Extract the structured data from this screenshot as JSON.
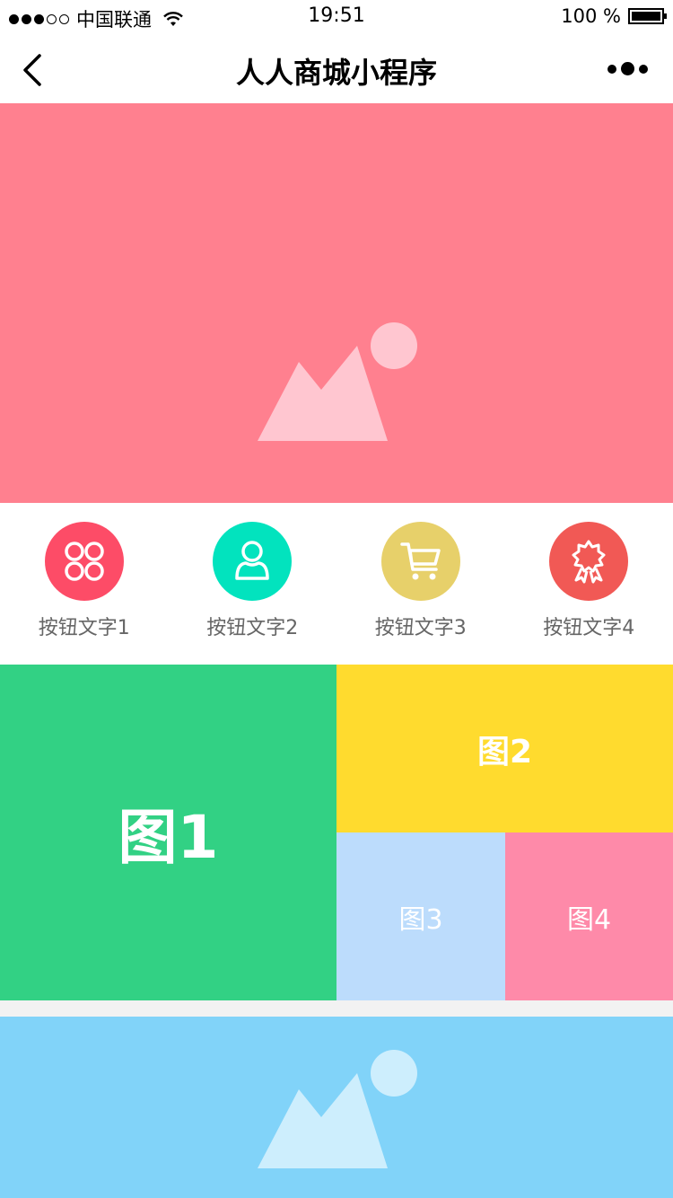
{
  "status_bar": {
    "carrier": "中国联通",
    "time": "19:51",
    "battery": "100 %"
  },
  "nav": {
    "title": "人人商城小程序"
  },
  "banner": {
    "color": "#ff808f",
    "dot_count": 3
  },
  "buttons": [
    {
      "label": "按钮文字1",
      "color": "#fd4c67",
      "icon": "grid-icon"
    },
    {
      "label": "按钮文字2",
      "color": "#02e3be",
      "icon": "user-icon"
    },
    {
      "label": "按钮文字3",
      "color": "#e7d06a",
      "icon": "cart-icon"
    },
    {
      "label": "按钮文字4",
      "color": "#f15955",
      "icon": "badge-icon"
    }
  ],
  "tiles": [
    {
      "label": "图1",
      "color": "#32d184"
    },
    {
      "label": "图2",
      "color": "#ffdb2e"
    },
    {
      "label": "图3",
      "color": "#bcdcfc"
    },
    {
      "label": "图4",
      "color": "#fe8aa9"
    }
  ],
  "banner2": {
    "color": "#81d3f9"
  }
}
